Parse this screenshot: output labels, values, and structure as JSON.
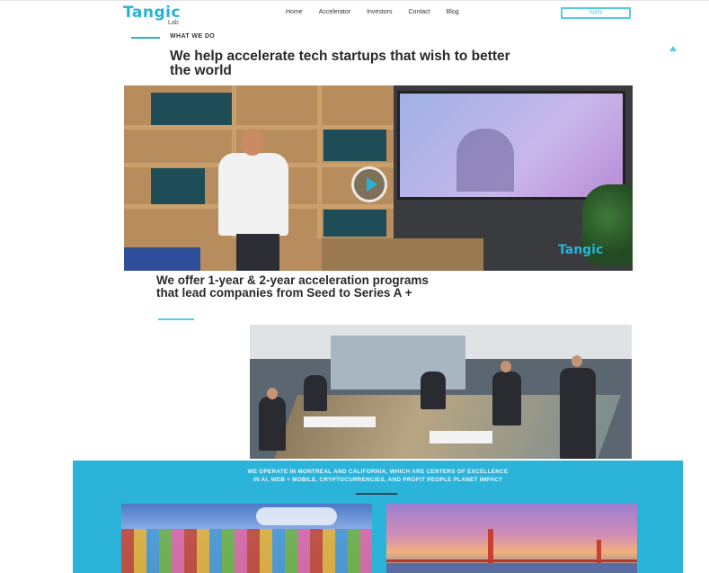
{
  "header": {
    "logo": "Tangic",
    "logo_sub": "Lab",
    "nav": [
      "Home",
      "Accelerator",
      "Investors",
      "Contact",
      "Blog"
    ],
    "cta_label": "Apply"
  },
  "intro": {
    "kicker": "WHAT WE DO",
    "headline": "We help accelerate tech startups that wish to better the world"
  },
  "hero": {
    "watermark": "Tangic"
  },
  "programs": {
    "headline": "We offer 1-year & 2-year acceleration programs that lead companies from Seed to Series A +"
  },
  "locations": {
    "text_line1": "WE OPERATE IN MONTREAL AND CALIFORNIA, WHICH ARE CENTERS OF EXCELLENCE",
    "text_line2": "IN AI, WEB + MOBILE, CRYPTOCURRENCIES, AND PROFIT PEOPLE PLANET IMPACT"
  },
  "colors": {
    "accent": "#27b3d6",
    "section_bg": "#2bb3d9"
  }
}
